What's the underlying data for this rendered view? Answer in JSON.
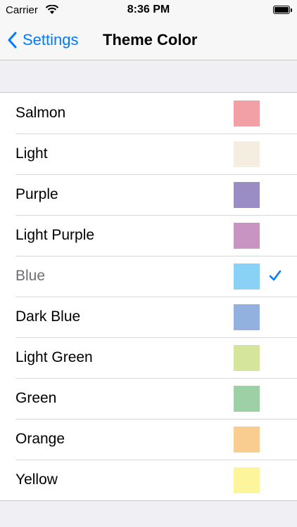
{
  "status_bar": {
    "carrier": "Carrier",
    "time": "8:36 PM",
    "wifi_icon": "wifi-icon",
    "battery_icon": "battery-icon"
  },
  "nav": {
    "back_label": "Settings",
    "title": "Theme Color"
  },
  "colors": {
    "accent": "#007aff"
  },
  "themes": [
    {
      "label": "Salmon",
      "color": "#f2a0a5",
      "selected": false
    },
    {
      "label": "Light",
      "color": "#f4ede0",
      "selected": false
    },
    {
      "label": "Purple",
      "color": "#9a8dc6",
      "selected": false
    },
    {
      "label": "Light Purple",
      "color": "#c894c2",
      "selected": false
    },
    {
      "label": "Blue",
      "color": "#89d1f5",
      "selected": true
    },
    {
      "label": "Dark Blue",
      "color": "#93b1de",
      "selected": false
    },
    {
      "label": "Light Green",
      "color": "#d5e59c",
      "selected": false
    },
    {
      "label": "Green",
      "color": "#9dd0a4",
      "selected": false
    },
    {
      "label": "Orange",
      "color": "#f8cd8f",
      "selected": false
    },
    {
      "label": "Yellow",
      "color": "#fdf59b",
      "selected": false
    }
  ]
}
